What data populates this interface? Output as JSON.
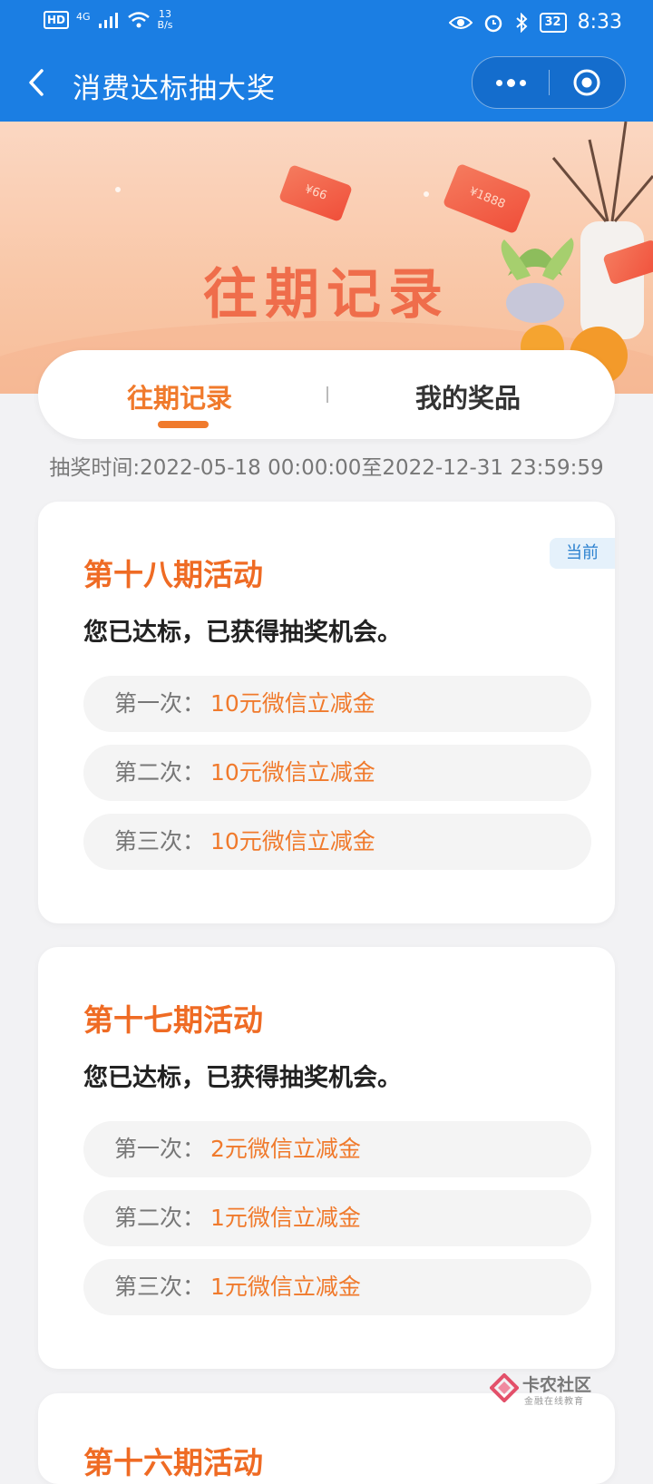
{
  "status_bar": {
    "hd": "HD",
    "network": "4G",
    "speed_value": "13",
    "speed_unit": "B/s",
    "battery": "32",
    "time": "8:33"
  },
  "title_bar": {
    "title": "消费达标抽大奖"
  },
  "banner": {
    "title": "往期记录",
    "envelope_1": "¥66",
    "envelope_2": "¥1888"
  },
  "tabs": [
    {
      "label": "往期记录",
      "active": true
    },
    {
      "label": "我的奖品",
      "active": false
    }
  ],
  "period_text": "抽奖时间:2022-05-18 00:00:00至2022-12-31 23:59:59",
  "activities": [
    {
      "title": "第十八期活动",
      "badge": "当前",
      "status": "您已达标，已获得抽奖机会。",
      "draws": [
        {
          "label": "第一次：",
          "prize": "10元微信立减金"
        },
        {
          "label": "第二次：",
          "prize": "10元微信立减金"
        },
        {
          "label": "第三次：",
          "prize": "10元微信立减金"
        }
      ]
    },
    {
      "title": "第十七期活动",
      "status": "您已达标，已获得抽奖机会。",
      "draws": [
        {
          "label": "第一次：",
          "prize": "2元微信立减金"
        },
        {
          "label": "第二次：",
          "prize": "1元微信立减金"
        },
        {
          "label": "第三次：",
          "prize": "1元微信立减金"
        }
      ]
    },
    {
      "title": "第十六期活动"
    }
  ],
  "watermark": {
    "name": "卡农社区",
    "sub": "金融在线教育"
  },
  "colors": {
    "header_blue": "#1b7ee3",
    "accent_orange": "#f07a2c",
    "badge_blue": "#2a80cf"
  }
}
